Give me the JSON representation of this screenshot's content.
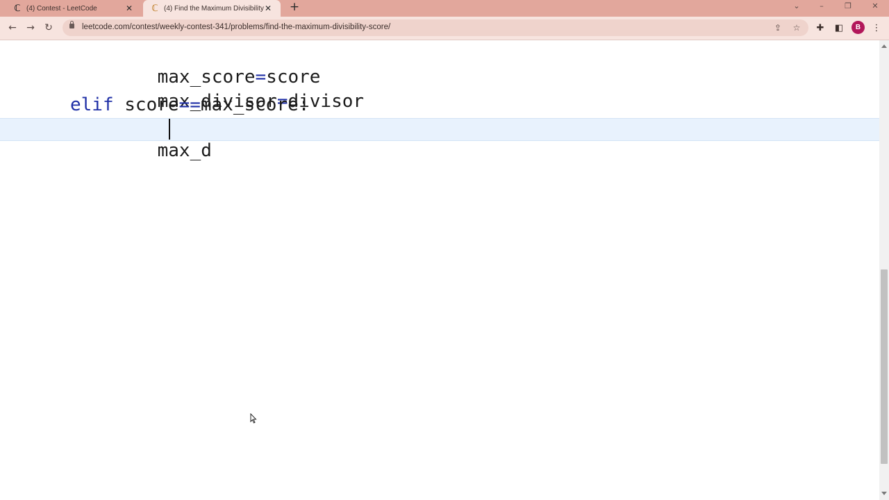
{
  "browser": {
    "tabs": [
      {
        "title": "(4) Contest - LeetCode",
        "favicon": "leetcode-icon",
        "active": false
      },
      {
        "title": "(4) Find the Maximum Divisibility",
        "favicon": "leetcode-icon",
        "active": true
      }
    ],
    "new_tab_label": "+",
    "url": "leetcode.com/contest/weekly-contest-341/problems/find-the-maximum-divisibility-score/",
    "profile_initial": "B",
    "profile_color": "#b2175a",
    "frame_color": "#e2a79c"
  },
  "editor": {
    "lines": [
      {
        "indent": "    ",
        "text": "max_score=score"
      },
      {
        "indent": "    ",
        "text": "max_divisor=divisor"
      },
      {
        "keyword": "elif",
        "rest": " score==max_score:"
      },
      {
        "indent": "    ",
        "text": "max_d"
      }
    ],
    "active_line_color": "#e8f2fd",
    "keyword_color": "#1f2fa6"
  }
}
